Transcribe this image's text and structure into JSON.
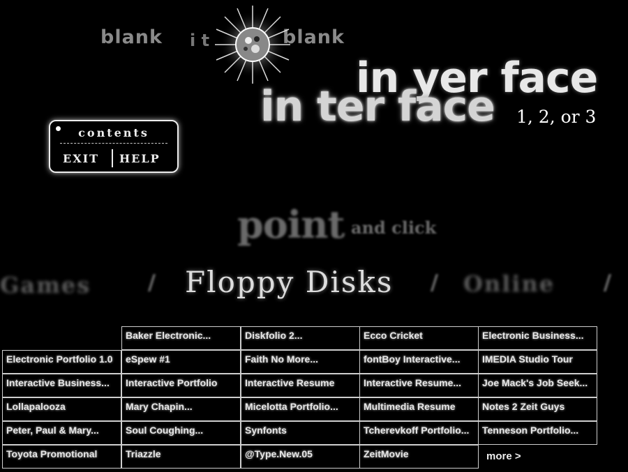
{
  "header": {
    "blank_left": "blank",
    "blank_mid": "i t",
    "blank_right": "blank",
    "title_back": "in yer face",
    "title_front": "in ter face",
    "title_sub": "1, 2, or 3"
  },
  "menu": {
    "contents": "contents",
    "exit": "EXIT",
    "help": "HELP"
  },
  "prompt": {
    "point": "point",
    "and_click": "and click"
  },
  "categories": {
    "left": "Games",
    "current": "Floppy Disks",
    "right": "Online"
  },
  "grid": {
    "rows": [
      [
        "",
        "Baker Electronic...",
        "Diskfolio 2...",
        "Ecco Cricket",
        "Electronic Business..."
      ],
      [
        "Electronic Portfolio 1.0",
        "eSpew #1",
        "Faith No More...",
        "fontBoy Interactive...",
        "IMEDIA Studio Tour"
      ],
      [
        "Interactive Business...",
        "Interactive Portfolio",
        "Interactive Resume",
        "Interactive Resume...",
        "Joe Mack's Job Seek..."
      ],
      [
        "Lollapalooza",
        "Mary Chapin...",
        "Micelotta Portfolio...",
        "Multimedia Resume",
        "Notes 2 Zeit Guys"
      ],
      [
        "Peter, Paul & Mary...",
        "Soul Coughing...",
        "Synfonts",
        "Tcherevkoff Portfolio...",
        "Tenneson Portfolio..."
      ],
      [
        "Toyota Promotional",
        "Triazzle",
        "@Type.New.05",
        "ZeitMovie",
        ""
      ]
    ],
    "more": "more >"
  },
  "colors": {
    "background": "#000000",
    "text": "#e6e6e6",
    "border": "#cfcfcf"
  }
}
